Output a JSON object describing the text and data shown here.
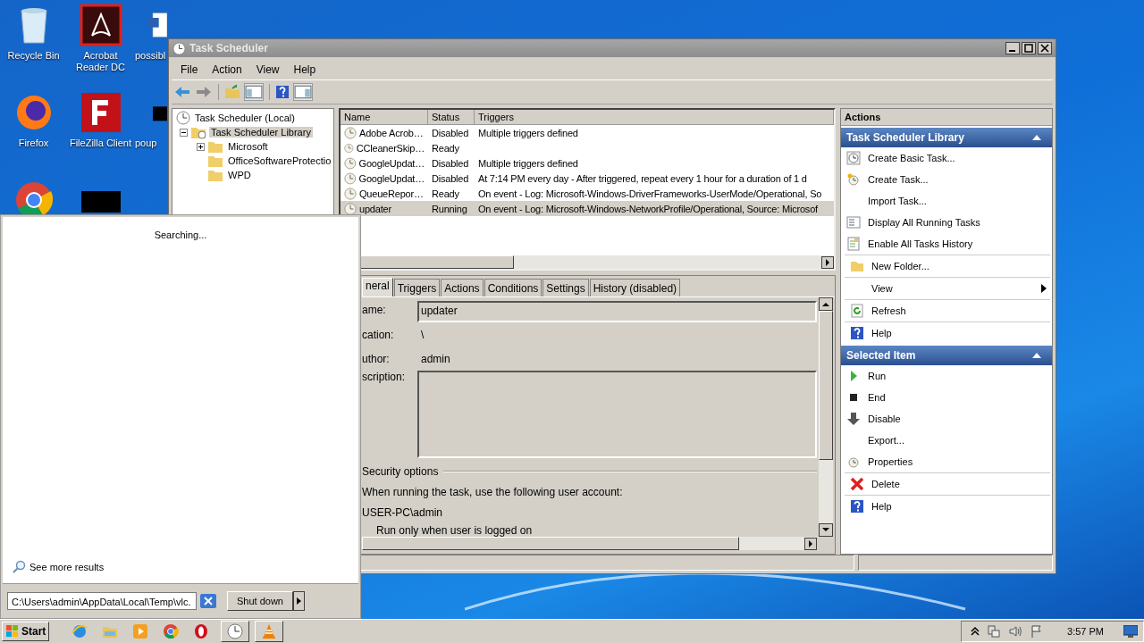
{
  "desktop_icons": [
    {
      "label": "Recycle Bin",
      "kind": "recycle"
    },
    {
      "label": "Acrobat Reader DC",
      "kind": "acrobat"
    },
    {
      "label": "possibl",
      "kind": "word"
    },
    {
      "label": "Firefox",
      "kind": "firefox"
    },
    {
      "label": "FileZilla Client",
      "kind": "filezilla"
    },
    {
      "label": "poup",
      "kind": "black"
    },
    {
      "kind": "chrome"
    },
    {
      "kind": "black"
    }
  ],
  "window": {
    "title": "Task Scheduler",
    "menu": [
      "File",
      "Action",
      "View",
      "Help"
    ],
    "tree": [
      {
        "label": "Task Scheduler (Local)",
        "selected": false,
        "children": [
          {
            "label": "Task Scheduler Library",
            "selected": true,
            "expanded": true,
            "children": [
              {
                "label": "Microsoft",
                "selected": false,
                "expanded": false
              },
              {
                "label": "OfficeSoftwareProtectio",
                "selected": false
              },
              {
                "label": "WPD",
                "selected": false
              }
            ]
          }
        ]
      }
    ],
    "task_table": {
      "columns": [
        "Name",
        "Status",
        "Triggers"
      ],
      "rows": [
        {
          "name": "Adobe Acrob…",
          "status": "Disabled",
          "triggers": "Multiple triggers defined",
          "selected": false
        },
        {
          "name": "CCleanerSkip…",
          "status": "Ready",
          "selected": false
        },
        {
          "name": "GoogleUpdat…",
          "status": "Disabled",
          "triggers": "Multiple triggers defined",
          "selected": false
        },
        {
          "name": "GoogleUpdat…",
          "status": "Disabled",
          "triggers": "At 7:14 PM every day - After triggered, repeat every 1 hour for a duration of 1 d",
          "selected": false
        },
        {
          "name": "QueueRepor…",
          "status": "Ready",
          "triggers": "On event - Log: Microsoft-Windows-DriverFrameworks-UserMode/Operational, So",
          "selected": false
        },
        {
          "name": "updater",
          "status": "Running",
          "triggers": "On event - Log: Microsoft-Windows-NetworkProfile/Operational, Source: Microsof",
          "selected": true
        }
      ]
    },
    "detail_tabs": [
      {
        "label": "neral",
        "selected": true
      },
      {
        "label": "Triggers",
        "selected": false
      },
      {
        "label": "Actions",
        "selected": false
      },
      {
        "label": "Conditions",
        "selected": false
      },
      {
        "label": "Settings",
        "selected": false
      },
      {
        "label": "History (disabled)",
        "selected": false
      }
    ],
    "general": {
      "name_label": "ame:",
      "name_value": "updater",
      "location_label": "cation:",
      "location_value": "\\",
      "author_label": "uthor:",
      "author_value": "admin",
      "description_label": "scription:",
      "security_title": "Security options",
      "account_text": "When running the task, use the following user account:",
      "account": "USER-PC\\admin",
      "run_option": "Run only when user is logged on"
    },
    "actions": {
      "header": "Actions",
      "sections": [
        {
          "title": "Task Scheduler Library",
          "groups": [
            [
              {
                "label": "Create Basic Task...",
                "kind": "basic"
              },
              {
                "label": "Create Task...",
                "kind": "create"
              },
              {
                "label": "Import Task...",
                "kind": "plain"
              },
              {
                "label": "Display All Running Tasks",
                "kind": "list"
              },
              {
                "label": "Enable All Tasks History",
                "kind": "history"
              }
            ],
            [
              {
                "label": "New Folder...",
                "kind": "folder"
              }
            ],
            [
              {
                "label": "View",
                "kind": "submenu"
              }
            ],
            [
              {
                "label": "Refresh",
                "kind": "refresh"
              }
            ],
            [
              {
                "label": "Help",
                "kind": "help"
              }
            ]
          ]
        },
        {
          "title": "Selected Item",
          "groups": [
            [
              {
                "label": "Run",
                "kind": "run"
              },
              {
                "label": "End",
                "kind": "end"
              },
              {
                "label": "Disable",
                "kind": "disable"
              },
              {
                "label": "Export...",
                "kind": "plain"
              },
              {
                "label": "Properties",
                "kind": "properties"
              }
            ],
            [
              {
                "label": "Delete",
                "kind": "delete"
              }
            ],
            [
              {
                "label": "Help",
                "kind": "help"
              }
            ]
          ]
        }
      ]
    }
  },
  "start_menu": {
    "status": "Searching...",
    "more_results": "See more results",
    "search_value": "C:\\Users\\admin\\AppData\\Local\\Temp\\vlc.",
    "shutdown": "Shut down"
  },
  "taskbar": {
    "start": "Start",
    "apps": [
      {
        "kind": "ie",
        "active": false
      },
      {
        "kind": "explorer",
        "active": false
      },
      {
        "kind": "media",
        "active": false
      },
      {
        "kind": "chrome",
        "active": false
      },
      {
        "kind": "opera",
        "active": false
      },
      {
        "kind": "clock",
        "active": true
      },
      {
        "kind": "vlc",
        "active": true
      }
    ],
    "time": "3:57 PM"
  }
}
